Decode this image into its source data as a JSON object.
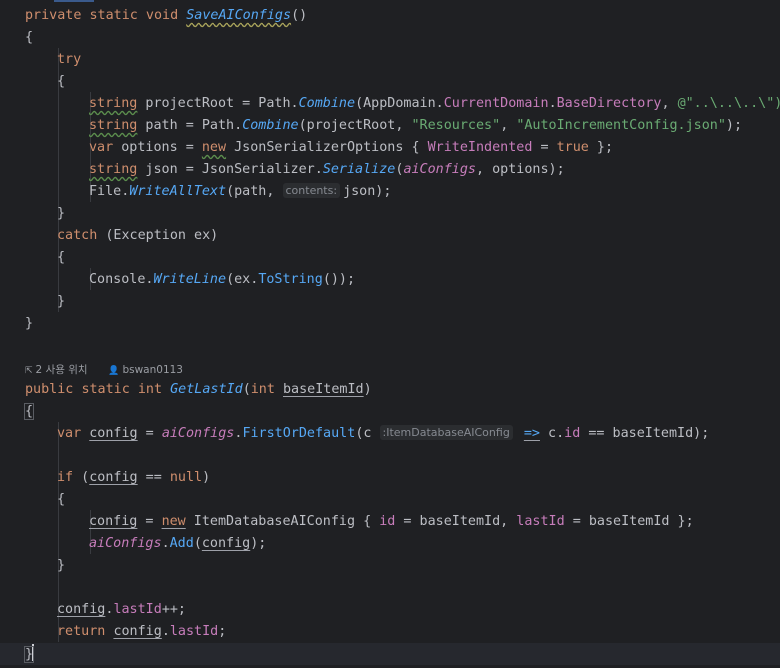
{
  "editor": {
    "save_method": {
      "signature_prefix": "private static void ",
      "name": "SaveAIConfigs",
      "signature_suffix": "()",
      "open_brace": "{",
      "try_kw": "try",
      "try_open": "{",
      "l1": {
        "type": "string",
        "decl": " projectRoot = Path.",
        "call": "Combine",
        "args_a": "(AppDomain.",
        "prop1": "CurrentDomain",
        "dot": ".",
        "prop2": "BaseDirectory",
        "comma": ", ",
        "str": "@\"..\\..\\..\\\")"
      },
      "l2": {
        "type": "string",
        "decl": " path = Path.",
        "call": "Combine",
        "args_a": "(projectRoot, ",
        "str1": "\"Resources\"",
        "comma": ", ",
        "str2": "\"AutoIncrementConfig.json\"",
        "end": ");"
      },
      "l3": {
        "type": "var",
        "decl": " options = ",
        "new_kw": "new",
        "rest": " JsonSerializerOptions { ",
        "prop": "WriteIndented",
        "eq": " = ",
        "val": "true",
        "end": " };"
      },
      "l4": {
        "type": "string",
        "decl": " json = JsonSerializer.",
        "call": "Serialize",
        "open": "(",
        "arg": "aiConfigs",
        "end": ", options);"
      },
      "l5": {
        "pre": "File.",
        "call": "WriteAllText",
        "open": "(path, ",
        "hint": "contents:",
        "end": "json);"
      },
      "try_close": "}",
      "catch_kw": "catch",
      "catch_rest": " (Exception ex)",
      "catch_open": "{",
      "l6": {
        "pre": "Console.",
        "call": "WriteLine",
        "mid": "(ex.",
        "call2": "ToString",
        "end": "());"
      },
      "catch_close": "}",
      "close_brace": "}"
    },
    "meta": {
      "usages": "2 사용 위치",
      "author": "bswan0113"
    },
    "get_method": {
      "kw_public": "public",
      "kw_static": "static",
      "kw_int": "int",
      "name": "GetLastId",
      "open": "(",
      "param_type": "int",
      "param_name": "baseItemId",
      "close": ")",
      "open_brace": "{",
      "l1": {
        "type": "var",
        "var_name": "config",
        "eq": " = ",
        "field": "aiConfigs",
        "dot": ".",
        "call": "FirstOrDefault",
        "open": "(c ",
        "hint": ":ItemDatabaseAIConfig",
        "arrow": "=>",
        "mid": " c.",
        "prop": "id",
        "end": " == baseItemId);"
      },
      "if_kw": "if",
      "if_open": " (",
      "if_var": "config",
      "if_mid": " == ",
      "if_null": "null",
      "if_close": ")",
      "if_brace_open": "{",
      "l2": {
        "var_name": "config",
        "eq": " = ",
        "new_kw": "new",
        "mid": " ItemDatabaseAIConfig { ",
        "p1": "id",
        "mid2": " = baseItemId, ",
        "p2": "lastId",
        "end": " = baseItemId };"
      },
      "l3": {
        "field": "aiConfigs",
        "dot": ".",
        "call": "Add",
        "open": "(",
        "arg": "config",
        "end": ");"
      },
      "if_brace_close": "}",
      "l4": {
        "var_name": "config",
        "dot": ".",
        "prop": "lastId",
        "end": "++;"
      },
      "l5": {
        "return_kw": "return",
        "sp": " ",
        "var_name": "config",
        "dot": ".",
        "prop": "lastId",
        "end": ";"
      },
      "close_brace": "}"
    }
  }
}
